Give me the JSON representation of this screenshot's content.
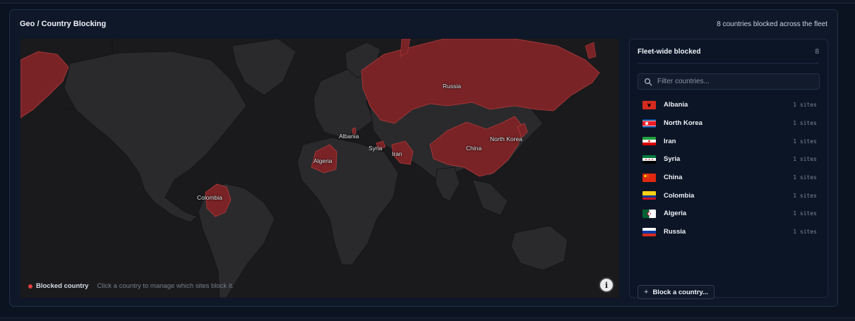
{
  "panel": {
    "title": "Geo / Country Blocking",
    "summary": "8 countries blocked across the fleet"
  },
  "map": {
    "legend_label": "Blocked country",
    "legend_hint": "Click a country to manage which sites block it.",
    "info_icon": "info-icon",
    "blocked_color": "#7a2326",
    "land_color": "#2a2a2d",
    "labels": {
      "russia": "Russia",
      "albania": "Albania",
      "syria": "Syria",
      "iran": "Iran",
      "algeria": "Algeria",
      "china": "China",
      "north_korea": "North Korea",
      "colombia": "Colombia"
    }
  },
  "sidebar": {
    "title": "Fleet-wide blocked",
    "count": "8",
    "filter_placeholder": "Filter countries...",
    "search_icon": "search-icon",
    "countries": [
      {
        "name": "Albania",
        "sites": "1 sites"
      },
      {
        "name": "North Korea",
        "sites": "1 sites"
      },
      {
        "name": "Iran",
        "sites": "1 sites"
      },
      {
        "name": "Syria",
        "sites": "1 sites"
      },
      {
        "name": "China",
        "sites": "1 sites"
      },
      {
        "name": "Colombia",
        "sites": "1 sites"
      },
      {
        "name": "Algeria",
        "sites": "1 sites"
      },
      {
        "name": "Russia",
        "sites": "1 sites"
      }
    ],
    "block_button_label": "Block a country..."
  },
  "colors": {
    "accent_red": "#e0403f",
    "panel_bg": "#0f1829"
  }
}
